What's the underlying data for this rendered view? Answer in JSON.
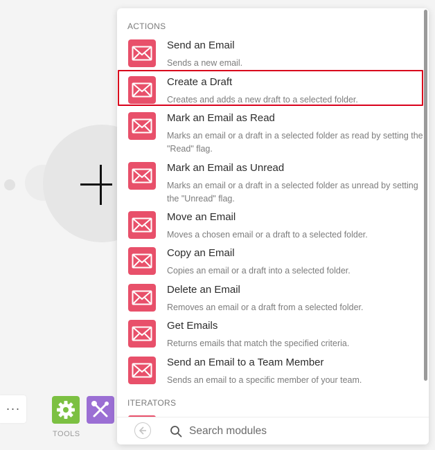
{
  "panel": {
    "sections": {
      "actions": "ACTIONS",
      "iterators": "ITERATORS"
    },
    "items": [
      {
        "title": "Send an Email",
        "desc": "Sends a new email."
      },
      {
        "title": "Create a Draft",
        "desc": "Creates and adds a new draft to a selected folder."
      },
      {
        "title": "Mark an Email as Read",
        "desc": "Marks an email or a draft in a selected folder as read by setting the \"Read\" flag."
      },
      {
        "title": "Mark an Email as Unread",
        "desc": "Marks an email or a draft in a selected folder as unread by setting the \"Unread\" flag."
      },
      {
        "title": "Move an Email",
        "desc": "Moves a chosen email or a draft to a selected folder."
      },
      {
        "title": "Copy an Email",
        "desc": "Copies an email or a draft into a selected folder."
      },
      {
        "title": "Delete an Email",
        "desc": "Removes an email or a draft from a selected folder."
      },
      {
        "title": "Get Emails",
        "desc": "Returns emails that match the specified criteria."
      },
      {
        "title": "Send an Email to a Team Member",
        "desc": "Sends an email to a specific member of your team."
      }
    ],
    "search": {
      "placeholder": "Search modules",
      "value": ""
    }
  },
  "canvas": {
    "more_label": "···",
    "tools_label": "TOOLS"
  },
  "colors": {
    "module_icon": "#e8506a",
    "highlight": "#d9001b",
    "tools_green": "#7cc042",
    "tools_purple": "#9b6fd4"
  },
  "icons": {
    "module": "envelope-icon",
    "back": "arrow-left-icon",
    "search": "search-icon",
    "tool_green": "gear-icon",
    "tool_purple": "wrench-screwdriver-icon"
  }
}
